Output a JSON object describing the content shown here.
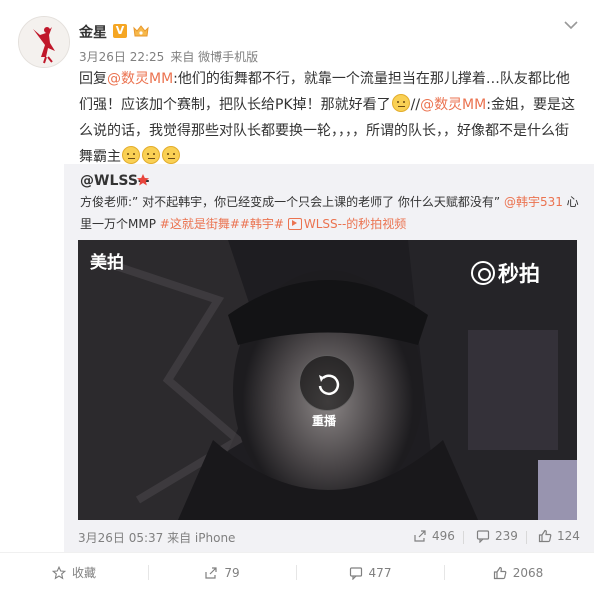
{
  "post": {
    "user_name": "金星",
    "verified_mark": "V",
    "time": "3月26日 22:25",
    "source": "来自 微博手机版",
    "text_parts": [
      "回复",
      "@数灵MM",
      ":他们的街舞都不行，就靠一个流量担当在那儿撑着…队友都比他们强！应该加个赛制，把队长给PK掉！那就好看了",
      "//",
      "@数灵MM",
      ":金姐，要是这么说的话，我觉得那些对队长都要换一轮，，，，所谓的队长，，好像都不是什么街舞霸主"
    ]
  },
  "repost": {
    "user": "@WLSS--",
    "text_parts": [
      "方俊老师:” 对不起韩宇，你已经变成一个只会上课的老师了 你什么天赋都没有” ",
      "@韩宇531",
      " 心里一万个MMP ",
      "#这就是街舞##韩宇#",
      "WLSS--的秒拍视频"
    ],
    "video": {
      "meipai_label": "美拍",
      "miaopai_label": "秒拍",
      "replay_label": "重播"
    },
    "footer": {
      "time": "3月26日 05:37 来自 iPhone",
      "reposts": "496",
      "comments": "239",
      "likes": "124"
    }
  },
  "actions": {
    "favorite": "收藏",
    "repost": "79",
    "comment": "477",
    "like": "2068"
  },
  "colors": {
    "link": "#eb7350",
    "verified": "#f5a623",
    "meta": "#808080",
    "repost_bg": "#f2f2f5"
  }
}
